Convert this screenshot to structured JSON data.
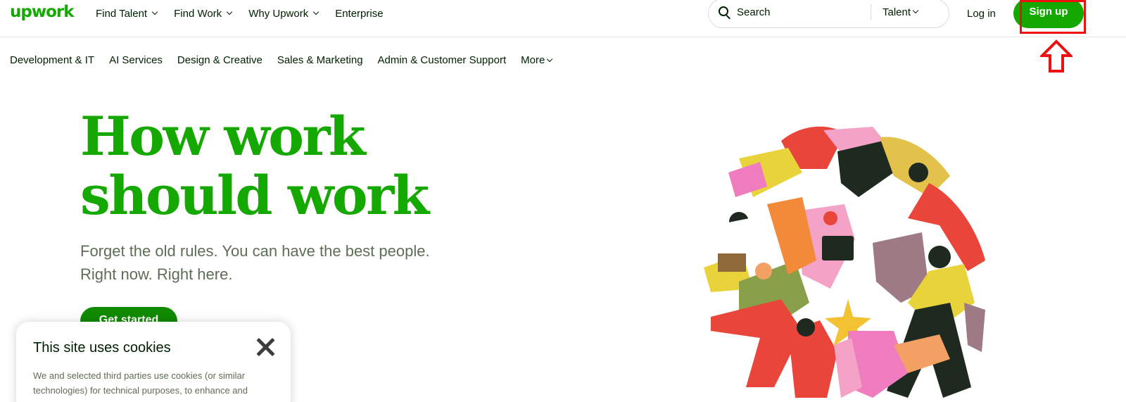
{
  "header": {
    "logo_text": "upwork",
    "nav": [
      {
        "label": "Find Talent",
        "has_dropdown": true
      },
      {
        "label": "Find Work",
        "has_dropdown": true
      },
      {
        "label": "Why Upwork",
        "has_dropdown": true
      },
      {
        "label": "Enterprise",
        "has_dropdown": false
      }
    ],
    "search": {
      "placeholder": "Search",
      "icon": "search-icon",
      "scope_label": "Talent"
    },
    "login_label": "Log in",
    "signup_label": "Sign up"
  },
  "categories": [
    {
      "label": "Development & IT"
    },
    {
      "label": "AI Services"
    },
    {
      "label": "Design & Creative"
    },
    {
      "label": "Sales & Marketing"
    },
    {
      "label": "Admin & Customer Support"
    },
    {
      "label": "More",
      "has_dropdown": true
    }
  ],
  "hero": {
    "title_line1": "How work",
    "title_line2": "should work",
    "subtitle_line1": "Forget the old rules. You can have the best people.",
    "subtitle_line2": "Right now. Right here.",
    "cta_label": "Get started"
  },
  "cookie_banner": {
    "title": "This site uses cookies",
    "body": "We and selected third parties use cookies (or similar technologies) for technical purposes, to enhance and"
  },
  "colors": {
    "brand_green": "#14a800",
    "cta_green": "#108a00",
    "highlight_red": "#ee1111",
    "text_dark": "#001e00",
    "text_muted": "#5e6d55"
  }
}
